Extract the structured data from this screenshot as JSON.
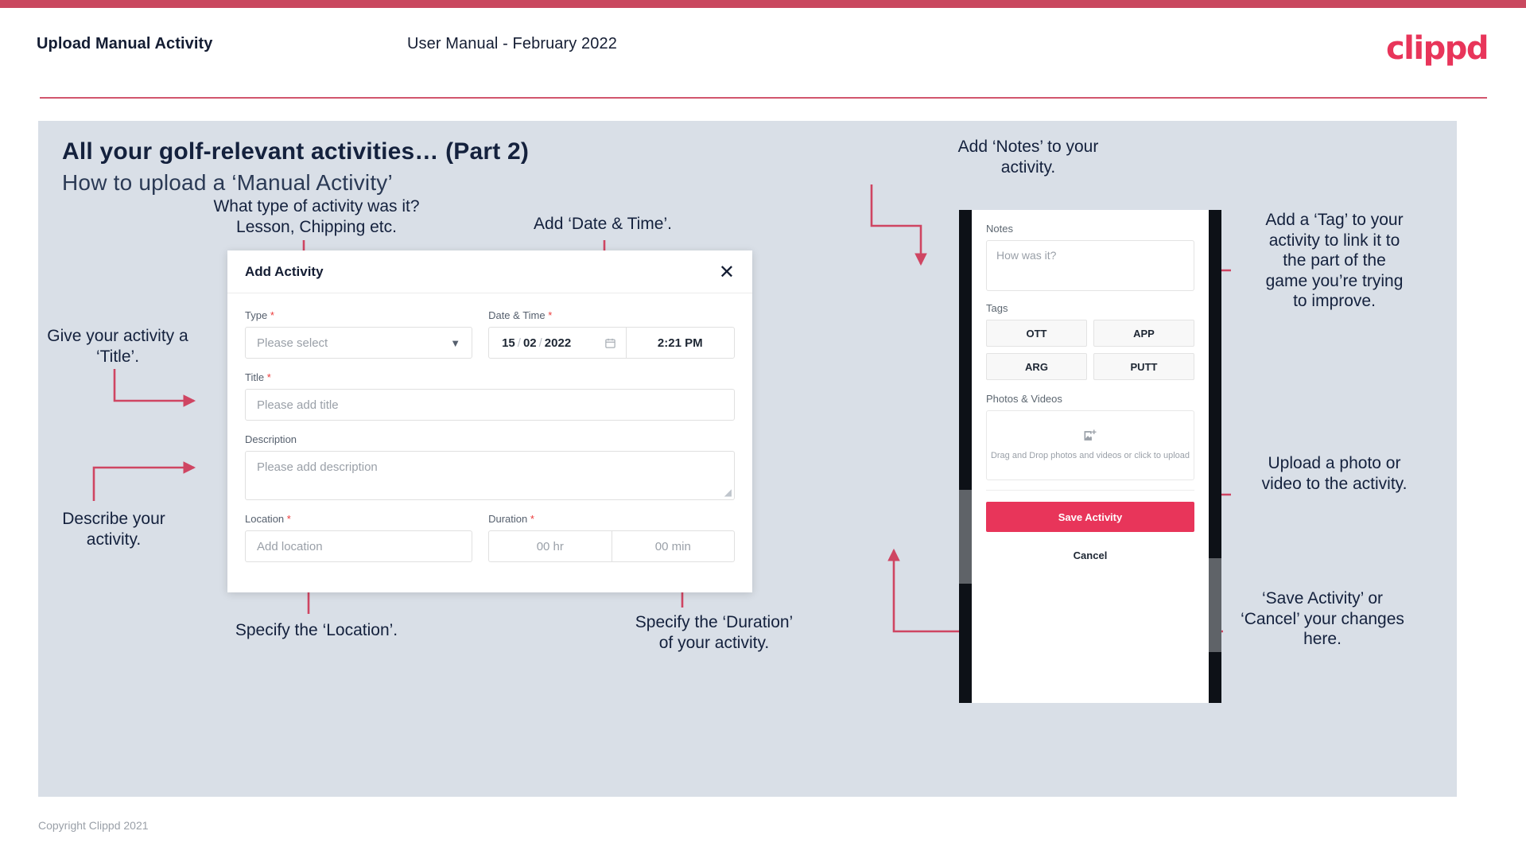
{
  "header": {
    "title": "Upload Manual Activity",
    "subtitle": "User Manual - February 2022",
    "logo": "clippd"
  },
  "slide": {
    "title": "All your golf-relevant activities… (Part 2)",
    "subtitle": "How to upload a ‘Manual Activity’"
  },
  "annotations": {
    "type": "What type of activity was it?\nLesson, Chipping etc.",
    "datetime": "Add ‘Date & Time’.",
    "title": "Give your activity a\n‘Title’.",
    "description": "Describe your\nactivity.",
    "location": "Specify the ‘Location’.",
    "duration": "Specify the ‘Duration’\nof your activity.",
    "notes": "Add ‘Notes’ to your\nactivity.",
    "tags": "Add a ‘Tag’ to your\nactivity to link it to\nthe part of the\ngame you’re trying\nto improve.",
    "upload": "Upload a photo or\nvideo to the activity.",
    "save": "‘Save Activity’ or\n‘Cancel’ your changes\nhere."
  },
  "modal": {
    "title": "Add Activity",
    "close_icon": "close-icon",
    "fields": {
      "type": {
        "label": "Type",
        "required": "*",
        "placeholder": "Please select",
        "chevron": "chevron-down-icon"
      },
      "datetime": {
        "label": "Date & Time",
        "required": "*",
        "day": "15",
        "month": "02",
        "year": "2022",
        "separator": "/",
        "time": "2:21 PM",
        "calendar_icon": "calendar-icon"
      },
      "title": {
        "label": "Title",
        "required": "*",
        "placeholder": "Please add title"
      },
      "description": {
        "label": "Description",
        "required": "",
        "placeholder": "Please add description"
      },
      "location": {
        "label": "Location",
        "required": "*",
        "placeholder": "Add location"
      },
      "duration": {
        "label": "Duration",
        "required": "*",
        "hours": "00 hr",
        "minutes": "00 min"
      }
    }
  },
  "phone": {
    "notes": {
      "label": "Notes",
      "placeholder": "How was it?"
    },
    "tags": {
      "label": "Tags",
      "items": [
        "OTT",
        "APP",
        "ARG",
        "PUTT"
      ]
    },
    "photos": {
      "label": "Photos & Videos",
      "icon": "add-image-icon",
      "drop_text": "Drag and Drop photos and videos or click to upload"
    },
    "save_label": "Save Activity",
    "cancel_label": "Cancel"
  },
  "footer": {
    "copyright": "Copyright Clippd 2021"
  },
  "colors": {
    "accent": "#e8355a",
    "top_bar": "#c9485f",
    "slide_bg": "#d9dfe7",
    "text_dark": "#14213d",
    "arrow": "#cf4562"
  }
}
